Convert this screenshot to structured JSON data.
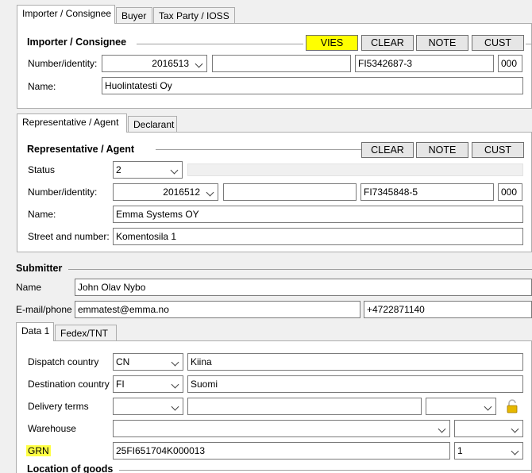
{
  "importer_tabs": [
    "Importer / Consignee",
    "Buyer",
    "Tax Party / IOSS"
  ],
  "importer": {
    "title": "Importer / Consignee",
    "buttons": [
      "VIES",
      "CLEAR",
      "NOTE",
      "CUST"
    ],
    "number_label": "Number/identity:",
    "number_value": "2016513",
    "number_extra": "",
    "vat_id": "FI5342687-3",
    "code": "000",
    "name_label": "Name:",
    "name_value": "Huolintatesti Oy"
  },
  "rep_tabs": [
    "Representative / Agent",
    "Declarant"
  ],
  "representative": {
    "title": "Representative / Agent",
    "buttons": [
      "CLEAR",
      "NOTE",
      "CUST"
    ],
    "status_label": "Status",
    "status_value": "2",
    "number_label": "Number/identity:",
    "number_value": "2016512",
    "number_extra": "",
    "vat_id": "FI7345848-5",
    "code": "000",
    "name_label": "Name:",
    "name_value": "Emma Systems OY",
    "street_label": "Street and number:",
    "street_value": "Komentosila 1"
  },
  "submitter": {
    "title": "Submitter",
    "name_label": "Name",
    "name_value": "John Olav Nybo",
    "email_label": "E-mail/phone",
    "email_value": "emmatest@emma.no",
    "phone_value": "+4722871140"
  },
  "data_tabs": [
    "Data 1",
    "Fedex/TNT"
  ],
  "data1": {
    "dispatch_label": "Dispatch country",
    "dispatch_code": "CN",
    "dispatch_name": "Kiina",
    "destination_label": "Destination country",
    "destination_code": "FI",
    "destination_name": "Suomi",
    "delivery_label": "Delivery terms",
    "delivery_code": "",
    "delivery_place": "",
    "delivery_extra": "",
    "warehouse_label": "Warehouse",
    "warehouse_value": "",
    "warehouse_extra": "",
    "grn_label": "GRN",
    "grn_value": "25FI651704K000013",
    "grn_count": "1",
    "location_label": "Location of goods"
  },
  "colors": {
    "vies_button": "#ffff00",
    "grn_highlight": "#ffff44"
  }
}
